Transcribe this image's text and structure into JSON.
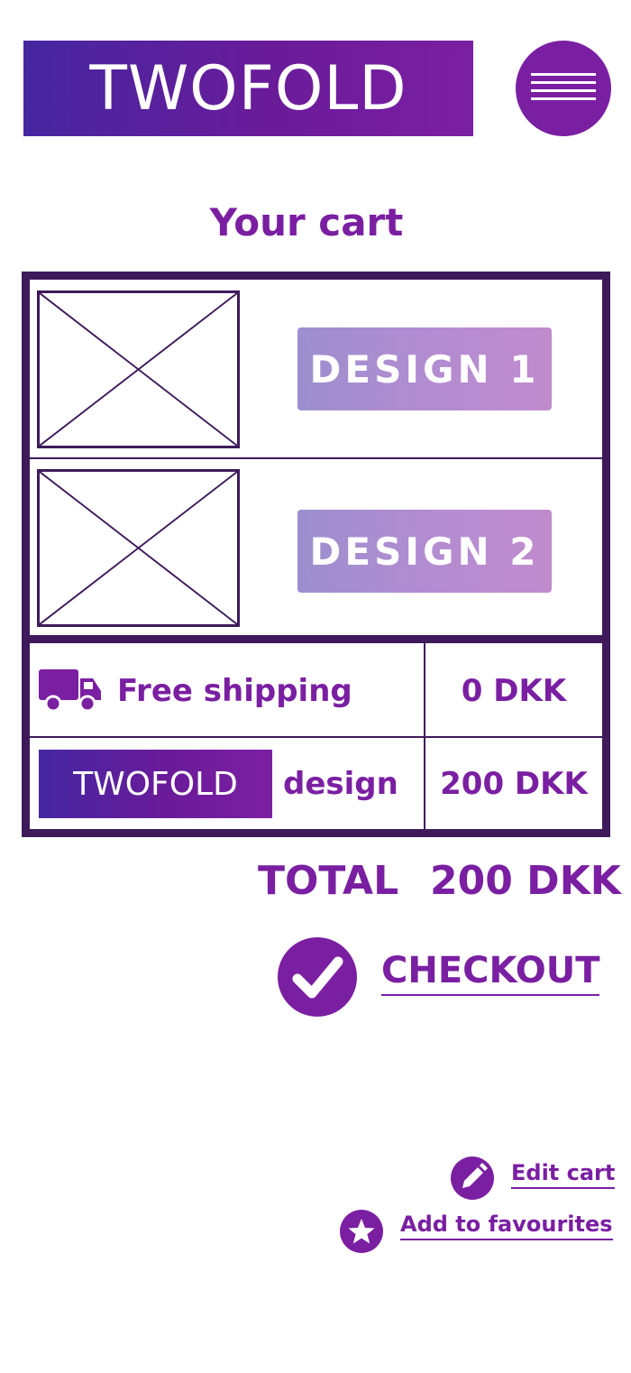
{
  "header": {
    "logo_text": "TWOFOLD",
    "menu_icon": "hamburger-menu-icon"
  },
  "page": {
    "title": "Your cart"
  },
  "cart": {
    "items": [
      {
        "image_icon": "image-placeholder-icon",
        "label": "DESIGN 1"
      },
      {
        "image_icon": "image-placeholder-icon",
        "label": "DESIGN 2"
      }
    ],
    "summary": [
      {
        "icon": "truck-icon",
        "label": "Free shipping",
        "price": "0 DKK"
      },
      {
        "logo": "TWOFOLD",
        "label": "design",
        "price": "200 DKK"
      }
    ]
  },
  "total": {
    "label": "TOTAL",
    "value": "200 DKK"
  },
  "actions": {
    "checkout": {
      "icon": "checkmark-icon",
      "label": "CHECKOUT"
    },
    "edit_cart": {
      "icon": "pencil-icon",
      "label": "Edit cart"
    },
    "add_favourites": {
      "icon": "star-icon",
      "label": "Add to favourites"
    }
  },
  "colors": {
    "brand_purple": "#7b1fa2",
    "dark_border": "#3e1a5b",
    "gradient_start": "#4527a0"
  }
}
